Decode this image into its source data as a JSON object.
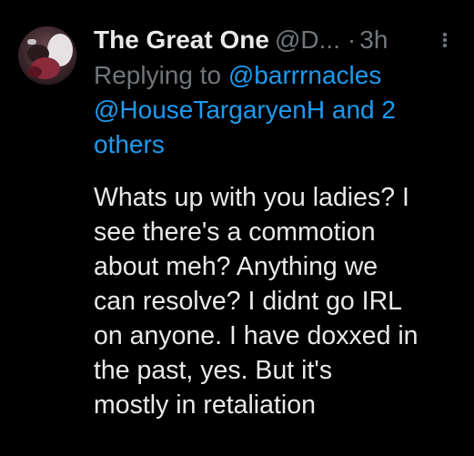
{
  "tweet": {
    "author": {
      "display_name": "The Great One",
      "handle": "@D...",
      "avatar_icon": "profile-avatar"
    },
    "separator": "·",
    "time": "3h",
    "more_icon": "more-vertical-icon",
    "reply": {
      "prefix": "Replying to ",
      "mention_1": "@barrrnacles",
      "mention_2": "@HouseTargaryenH and 2",
      "mention_3": "others"
    },
    "body_lines": [
      "Whats up with you ladies? I",
      "see there's a commotion",
      "about meh? Anything we",
      "can resolve? I didnt go IRL",
      "on anyone. I have doxxed in",
      "the past, yes. But it's",
      "mostly in retaliation"
    ]
  },
  "colors": {
    "background": "#000000",
    "text_primary": "#e7e9ea",
    "text_secondary": "#71767b",
    "link": "#1d9bf0"
  }
}
